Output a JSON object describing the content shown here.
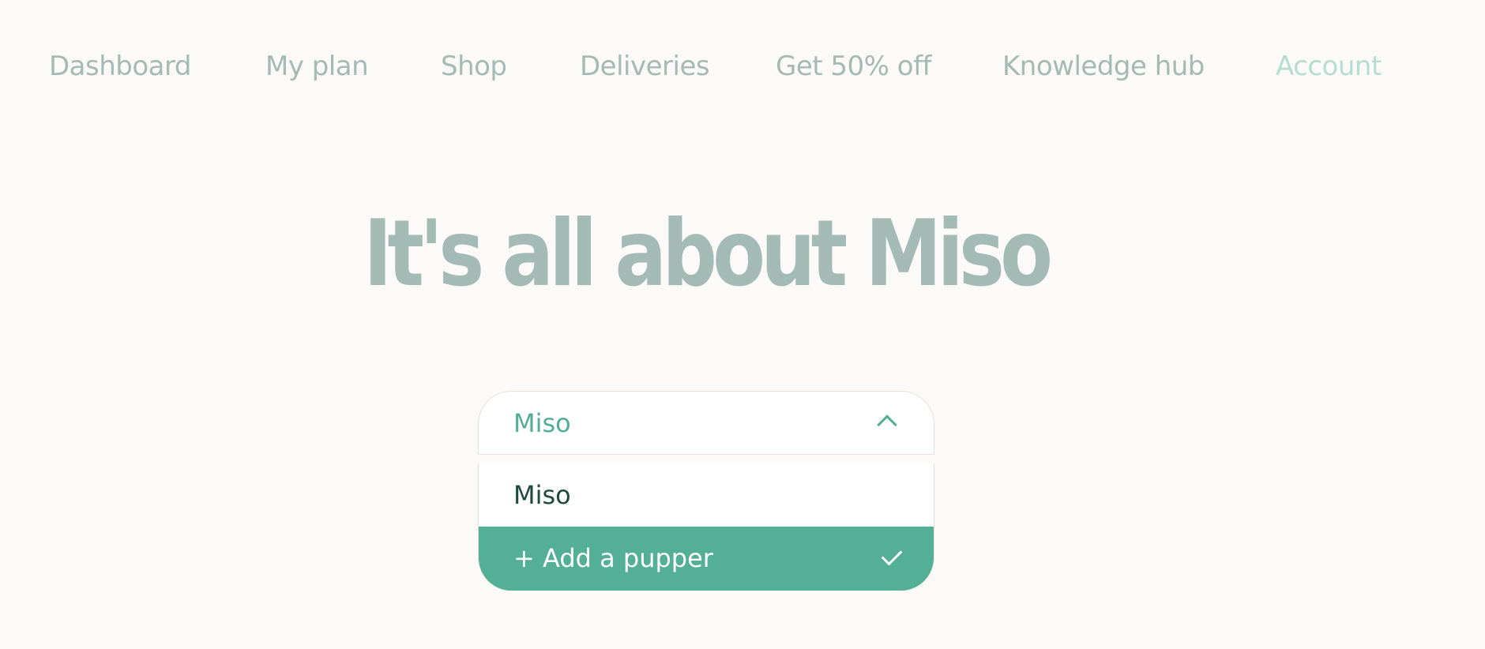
{
  "nav": {
    "items": [
      {
        "label": "Dashboard"
      },
      {
        "label": "My plan"
      },
      {
        "label": "Shop"
      },
      {
        "label": "Deliveries"
      },
      {
        "label": "Get 50% off"
      },
      {
        "label": "Knowledge hub"
      },
      {
        "label": "Account",
        "active": true
      }
    ]
  },
  "hero": {
    "title": "It's all about Miso"
  },
  "pet_select": {
    "selected": "Miso",
    "icon": "chevron-up-icon",
    "options": [
      {
        "label": "Miso"
      },
      {
        "label": "+ Add a pupper",
        "highlighted": true,
        "icon": "check-icon"
      }
    ]
  },
  "colors": {
    "background": "#fbfaf8",
    "nav_text": "#a5bab4",
    "nav_active": "#b5ddd2",
    "title": "#a4bab4",
    "accent_green": "#53af96",
    "option_text": "#1f4a3e"
  }
}
